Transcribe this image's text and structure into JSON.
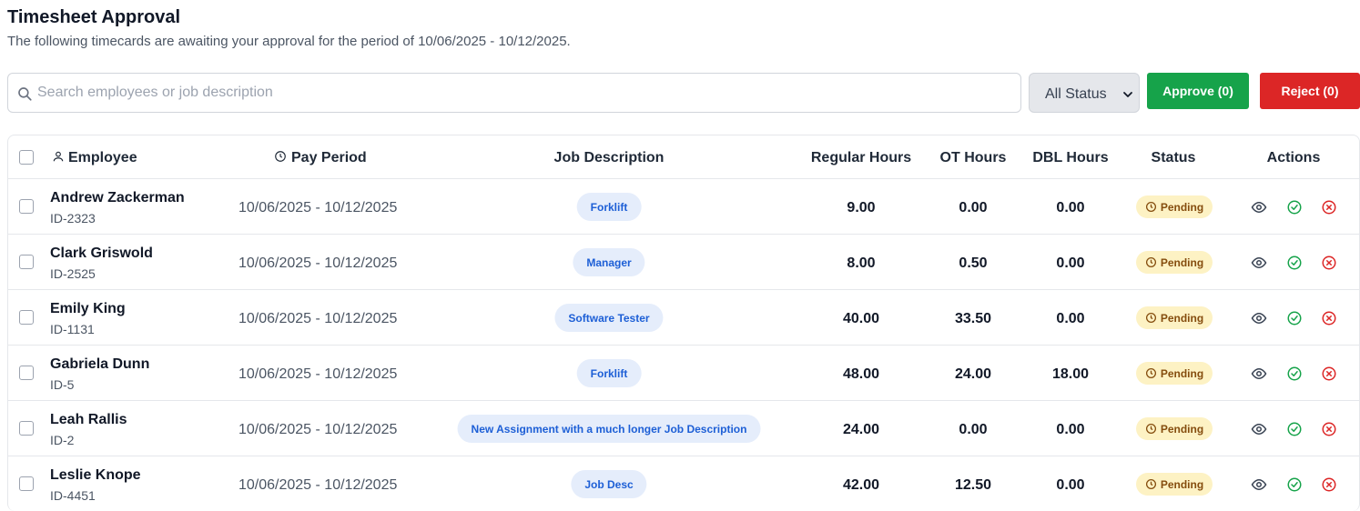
{
  "header": {
    "title": "Timesheet Approval",
    "subtitle": "The following timecards are awaiting your approval for the period of 10/06/2025 - 10/12/2025."
  },
  "toolbar": {
    "search_placeholder": "Search employees or job description",
    "status_filter": "All Status",
    "approve_label": "Approve (0)",
    "reject_label": "Reject (0)"
  },
  "colors": {
    "approve": "#16a34a",
    "reject": "#dc2626",
    "pending_bg": "#fdf2c4",
    "pending_text": "#854d0e",
    "pill_bg": "#e5edfb",
    "pill_text": "#1d5fd6"
  },
  "table": {
    "columns": {
      "employee": "Employee",
      "pay_period": "Pay Period",
      "job_description": "Job Description",
      "regular_hours": "Regular Hours",
      "ot_hours": "OT Hours",
      "dbl_hours": "DBL Hours",
      "status": "Status",
      "actions": "Actions"
    },
    "rows": [
      {
        "name": "Andrew Zackerman",
        "id": "ID-2323",
        "period": "10/06/2025 - 10/12/2025",
        "job": "Forklift",
        "regular": "9.00",
        "ot": "0.00",
        "dbl": "0.00",
        "status": "Pending"
      },
      {
        "name": "Clark Griswold",
        "id": "ID-2525",
        "period": "10/06/2025 - 10/12/2025",
        "job": "Manager",
        "regular": "8.00",
        "ot": "0.50",
        "dbl": "0.00",
        "status": "Pending"
      },
      {
        "name": "Emily King",
        "id": "ID-1131",
        "period": "10/06/2025 - 10/12/2025",
        "job": "Software Tester",
        "regular": "40.00",
        "ot": "33.50",
        "dbl": "0.00",
        "status": "Pending"
      },
      {
        "name": "Gabriela Dunn",
        "id": "ID-5",
        "period": "10/06/2025 - 10/12/2025",
        "job": "Forklift",
        "regular": "48.00",
        "ot": "24.00",
        "dbl": "18.00",
        "status": "Pending"
      },
      {
        "name": "Leah Rallis",
        "id": "ID-2",
        "period": "10/06/2025 - 10/12/2025",
        "job": "New Assignment with a much longer Job Description",
        "regular": "24.00",
        "ot": "0.00",
        "dbl": "0.00",
        "status": "Pending"
      },
      {
        "name": "Leslie Knope",
        "id": "ID-4451",
        "period": "10/06/2025 - 10/12/2025",
        "job": "Job Desc",
        "regular": "42.00",
        "ot": "12.50",
        "dbl": "0.00",
        "status": "Pending"
      }
    ]
  }
}
